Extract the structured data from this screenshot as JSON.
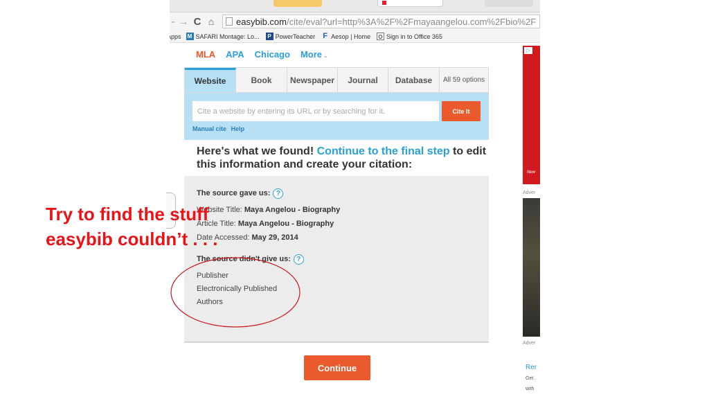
{
  "browser": {
    "url_domain": "easybib.com",
    "url_path": "/cite/eval?url=http%3A%2F%2Fmayaangelou.com%2Fbio%2F",
    "bookmarks": [
      {
        "icon": "M",
        "label": "SAFARI Montage: Lo..."
      },
      {
        "icon": "P",
        "label": "PowerTeacher"
      },
      {
        "icon": "F",
        "label": "Aesop | Home"
      },
      {
        "icon": "O",
        "label": "Sign in to Office 365"
      }
    ],
    "apps_label": "Apps"
  },
  "styles": {
    "items": [
      "MLA",
      "APA",
      "Chicago"
    ],
    "more_label": "More"
  },
  "source_tabs": [
    {
      "label": "Website",
      "active": true
    },
    {
      "label": "Book"
    },
    {
      "label": "Newspaper"
    },
    {
      "label": "Journal"
    },
    {
      "label": "Database"
    },
    {
      "label": "All 59 options"
    }
  ],
  "search": {
    "placeholder": "Cite a website by entering its URL or by searching for it.",
    "cite_button": "Cite It",
    "manual_cite": "Manual cite",
    "help": "Help"
  },
  "found_heading": {
    "prefix": "Here's what we found! ",
    "highlight": "Continue to the final step",
    "suffix": " to edit this information and create your citation:"
  },
  "results": {
    "gave_title": "The source gave us:",
    "gave_items": [
      {
        "label": "Website Title: ",
        "value": "Maya Angelou - Biography"
      },
      {
        "label": "Article Title: ",
        "value": "Maya Angelou - Biography"
      },
      {
        "label": "Date Accessed: ",
        "value": "May 29, 2014"
      }
    ],
    "missing_title": "The source didn't give us:",
    "missing_items": [
      "Publisher",
      "Electronically Published",
      "Authors"
    ],
    "help_glyph": "?"
  },
  "continue_label": "Continue",
  "side_ad": {
    "adchoices_glyph": "▷",
    "ad_word": "New",
    "label_1": "Adver",
    "label_2": "Adver",
    "link": "Rer",
    "sub_1": "Get .",
    "sub_2": "with"
  },
  "annotation": {
    "line1": "Try to find the stuff",
    "line2": "easybib couldn’t . . .",
    "color": "#e8141a"
  }
}
